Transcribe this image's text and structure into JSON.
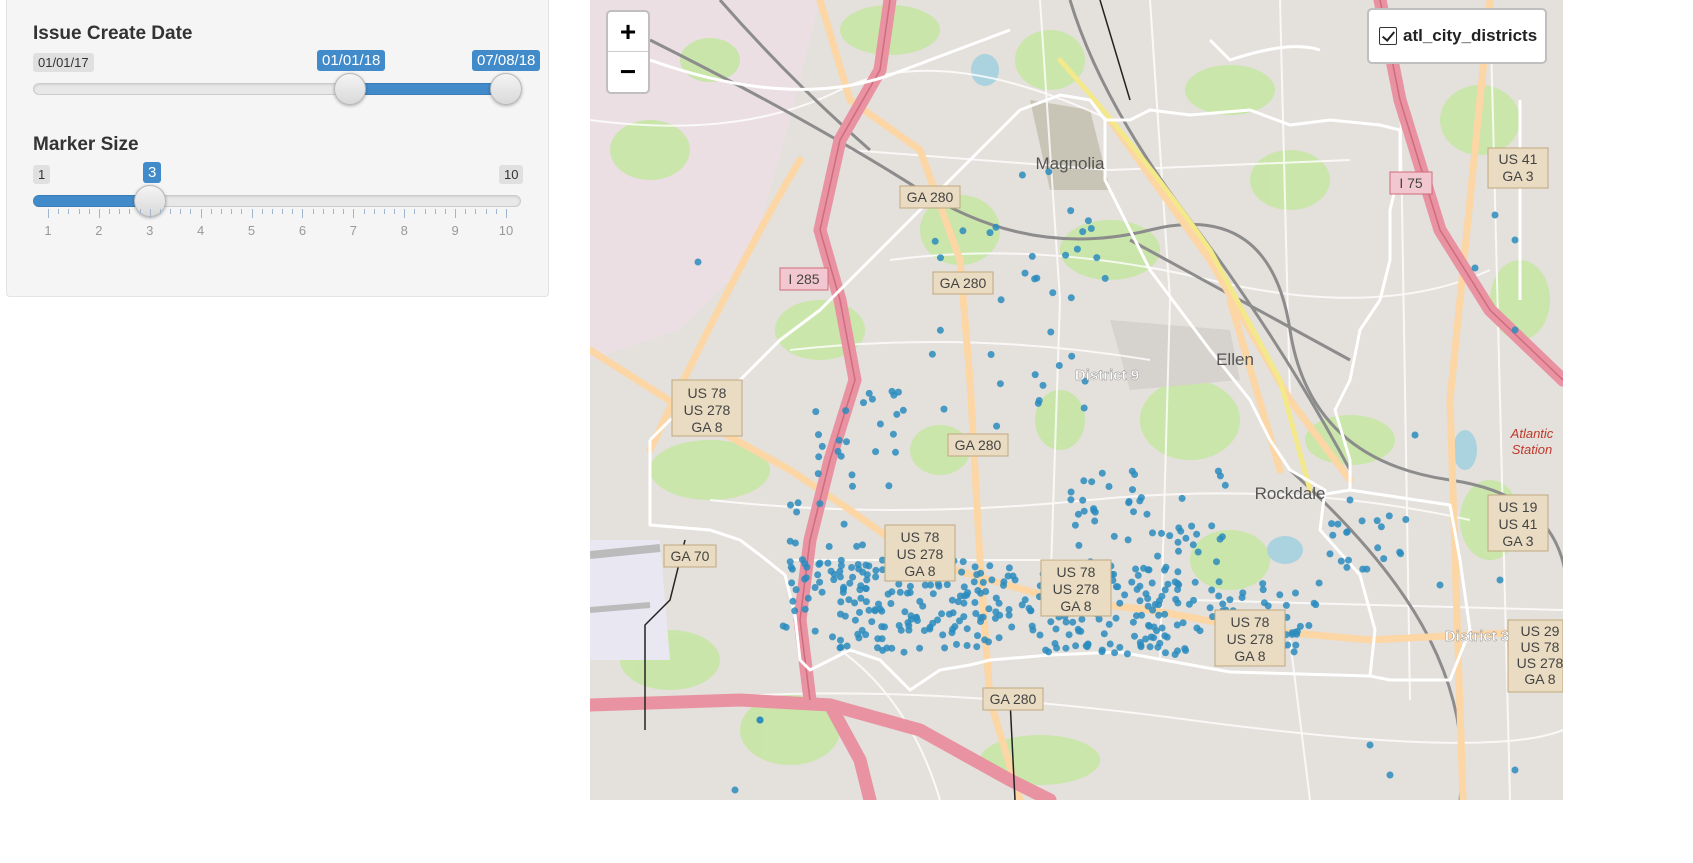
{
  "date_slider": {
    "label": "Issue Create Date",
    "min": "01/01/17",
    "from": "01/01/18",
    "to": "07/08/18",
    "from_fraction": 0.65,
    "to_fraction": 1.0
  },
  "size_slider": {
    "label": "Marker Size",
    "min": "1",
    "max": "10",
    "value": "3",
    "value_fraction": 0.2222,
    "ticks": [
      "1",
      "2",
      "3",
      "4",
      "5",
      "6",
      "7",
      "8",
      "9",
      "10"
    ]
  },
  "map": {
    "zoom_in": "+",
    "zoom_out": "−",
    "layer_name": "atl_city_districts",
    "layer_checked": true,
    "district_labels": [
      "District 9",
      "District 3"
    ],
    "place_labels": [
      "Magnolia",
      "Ellen",
      "Rockdale",
      "Atlantic Station"
    ],
    "road_shields": [
      "GA 280",
      "GA 280",
      "GA 280",
      "GA 280",
      "I 285",
      "US 78 US 278 GA 8",
      "US 78 US 278 GA 8",
      "US 78 US 278 GA 8",
      "US 78 US 278 GA 8",
      "GA 70",
      "US 41 GA 3",
      "US 19 US 41 GA 3",
      "I 75",
      "US 29 US 78 US 278 GA 8"
    ],
    "colors": {
      "marker": "#2b8cbe",
      "district_outline": "#ffffff",
      "highway": "#e892a2",
      "primary_road": "#fcd6a4",
      "park": "#c8e6a8"
    }
  }
}
